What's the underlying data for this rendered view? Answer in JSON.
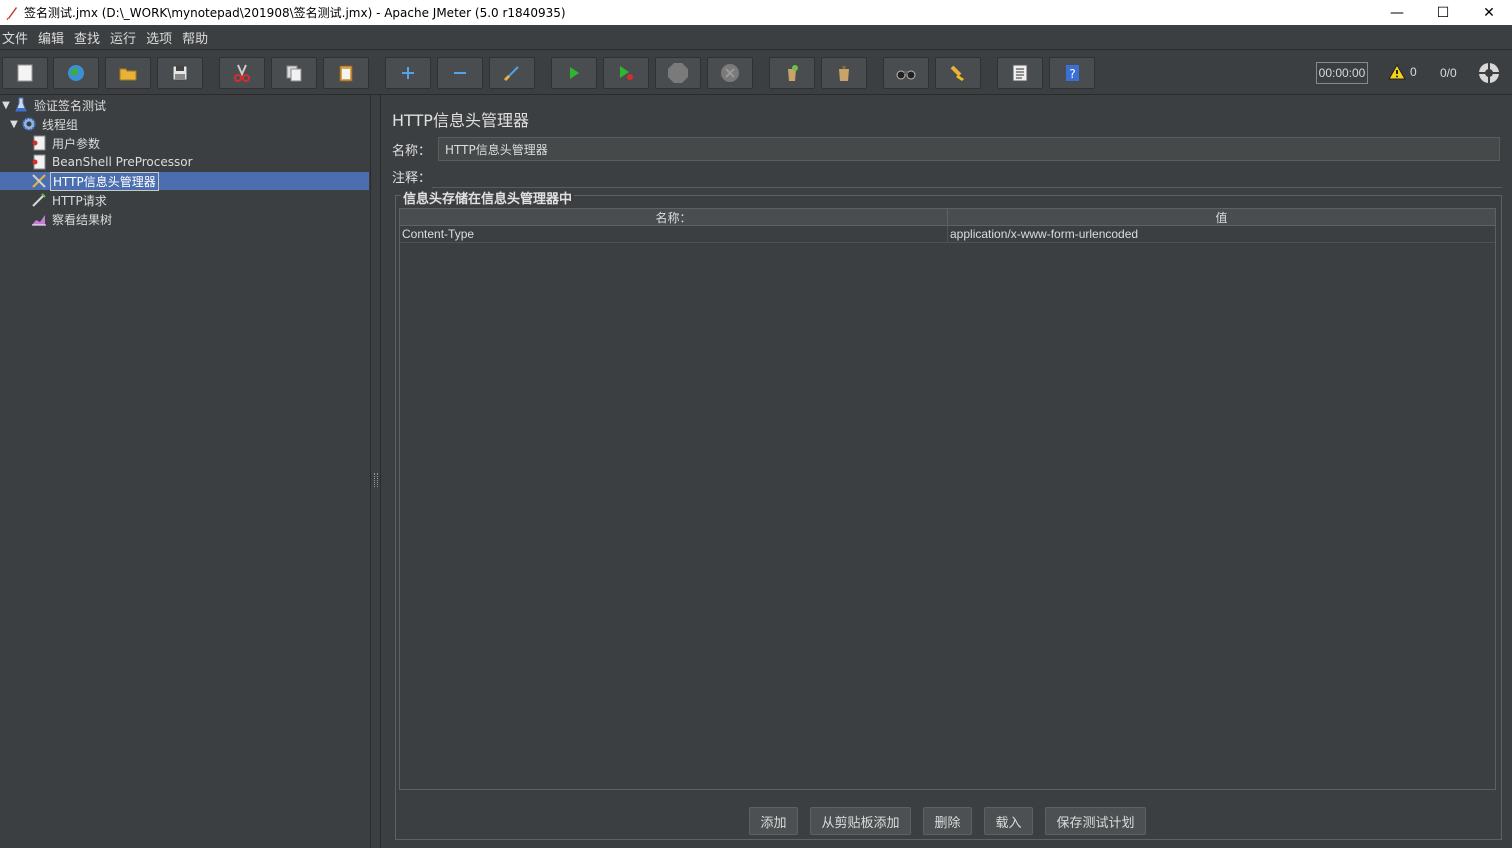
{
  "window": {
    "title": "签名测试.jmx (D:\\_WORK\\mynotepad\\201908\\签名测试.jmx) - Apache JMeter (5.0 r1840935)",
    "minimize": "—",
    "maximize": "☐",
    "close": "✕"
  },
  "menu": [
    "文件",
    "编辑",
    "查找",
    "运行",
    "选项",
    "帮助"
  ],
  "toolbar": {
    "buttons": [
      "new-icon",
      "templates-icon",
      "open-icon",
      "save-icon",
      "cut-icon",
      "copy-icon",
      "paste-icon",
      "expand-icon",
      "collapse-icon",
      "toggle-icon",
      "start-icon",
      "start-no-pause-icon",
      "stop-icon",
      "shutdown-icon",
      "clear-icon",
      "clear-all-icon",
      "search-icon",
      "reset-search-icon",
      "function-helper-icon",
      "help-icon"
    ],
    "timer": "00:00:00",
    "warnings": "0",
    "threads": "0/0"
  },
  "tree": {
    "root": "验证签名测试",
    "thread_group": "线程组",
    "children": [
      "用户参数",
      "BeanShell PreProcessor",
      "HTTP信息头管理器",
      "HTTP请求",
      "察看结果树"
    ],
    "selected": "HTTP信息头管理器"
  },
  "panel": {
    "title": "HTTP信息头管理器",
    "name_label": "名称：",
    "name_value": "HTTP信息头管理器",
    "comment_label": "注释：",
    "comment_value": "",
    "group_title": "信息头存储在信息头管理器中",
    "columns": [
      "名称：",
      "值"
    ],
    "rows": [
      {
        "name": "Content-Type",
        "value": "application/x-www-form-urlencoded"
      }
    ],
    "buttons": {
      "add": "添加",
      "add_from_clipboard": "从剪贴板添加",
      "delete": "删除",
      "load": "载入",
      "save": "保存测试计划"
    }
  },
  "colors": {
    "background": "#3c3f41",
    "selection": "#4b6eaf"
  }
}
